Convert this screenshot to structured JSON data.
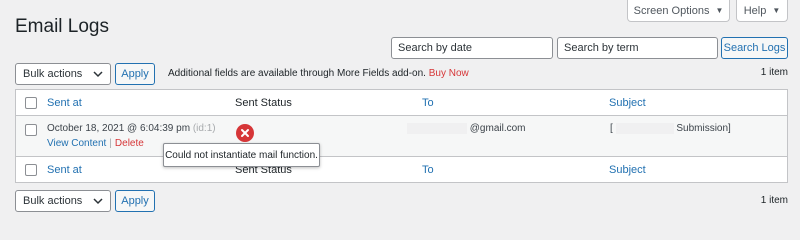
{
  "header": {
    "title": "Email Logs",
    "screen_options": "Screen Options",
    "help": "Help"
  },
  "search": {
    "date_placeholder": "Search by date",
    "term_placeholder": "Search by term",
    "button": "Search Logs"
  },
  "bulk_top": {
    "select": "Bulk actions",
    "apply": "Apply",
    "count": "1 item"
  },
  "bulk_bottom": {
    "select": "Bulk actions",
    "apply": "Apply",
    "count": "1 item"
  },
  "notice": {
    "text": "Additional fields are available through More Fields add-on.",
    "link": "Buy Now"
  },
  "table": {
    "columns": [
      "Sent at",
      "Sent Status",
      "To",
      "Subject"
    ],
    "rows": [
      {
        "sent_at": "October 18, 2021 @ 6:04:39 pm",
        "id_label": "(id:1)",
        "to": "@gmail.com",
        "subject_prefix": "[",
        "subject": "Submission]",
        "actions": {
          "view": "View Content",
          "separator": "|",
          "delete": "Delete"
        }
      }
    ]
  },
  "tooltip": "Could not instantiate mail function.",
  "colors": {
    "accent": "#2271b1",
    "error": "#d63638",
    "background": "#f0f0f1"
  },
  "icons": {
    "status_error": "error-x-icon",
    "dropdown": "chevron-down-icon"
  }
}
